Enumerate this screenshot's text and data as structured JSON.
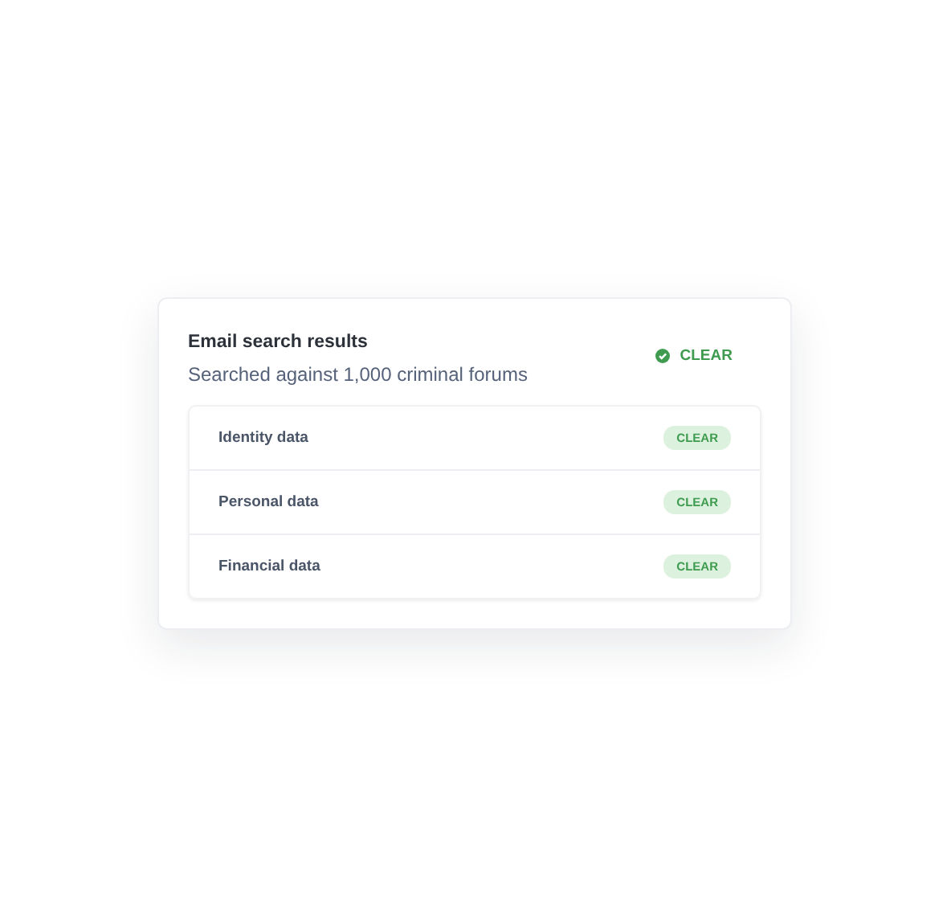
{
  "card": {
    "title": "Email search results",
    "subtitle": "Searched against 1,000 criminal forums",
    "status": {
      "kind": "clear",
      "label": "CLEAR"
    }
  },
  "results": [
    {
      "label": "Identity data",
      "status": {
        "kind": "clear",
        "label": "CLEAR"
      }
    },
    {
      "label": "Personal data",
      "status": {
        "kind": "clear",
        "label": "CLEAR"
      }
    },
    {
      "label": "Financial data",
      "status": {
        "kind": "clear",
        "label": "CLEAR"
      }
    }
  ]
}
